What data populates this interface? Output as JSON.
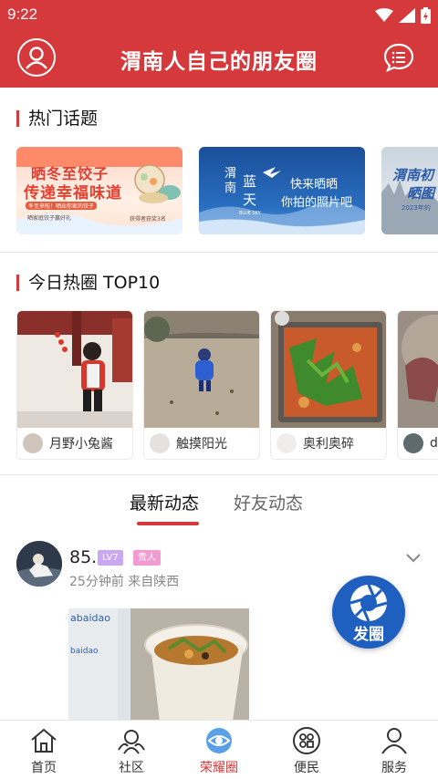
{
  "status_bar": {
    "time": "9:22"
  },
  "header": {
    "title": "渭南人自己的朋友圈"
  },
  "hot_topics": {
    "title": "热门话题",
    "cards": [
      {
        "line1": "晒冬至饺子",
        "line2": "传递幸福味道",
        "small1": "冬至来啦！晒出你家的饺子",
        "small2": "晒家庭饺子赢好礼",
        "small3": "获得者获奖3名"
      },
      {
        "left": "渭南",
        "mid": "蓝天",
        "right1": "快来晒晒",
        "right2": "你拍的照片吧",
        "tag": "BLUE SKY"
      },
      {
        "text1": "渭南初",
        "text2": "晒图",
        "small": "2023年的"
      }
    ]
  },
  "top10": {
    "title": "今日热圈 TOP10",
    "cards": [
      {
        "user": "月野小兔酱"
      },
      {
        "user": "触摸阳光"
      },
      {
        "user": "奥利奥碎"
      },
      {
        "user": "d"
      }
    ]
  },
  "feed_tabs": {
    "latest": "最新动态",
    "friends": "好友动态"
  },
  "post": {
    "name": "85.",
    "level": "LV7",
    "title_badge": "贵人",
    "meta": "25分钟前  来自陕西",
    "cup_text1": "abaidao",
    "cup_text2": "baidao"
  },
  "fab": {
    "label": "发圈"
  },
  "bottom_nav": {
    "home": "首页",
    "community": "社区",
    "honor": "荣耀圈",
    "service_people": "便民",
    "service": "服务"
  },
  "colors": {
    "brand_red": "#d6393b",
    "fab_blue": "#1f5fc0",
    "level_badge": "#c8a8f0",
    "title_badge": "#f29bd0"
  }
}
